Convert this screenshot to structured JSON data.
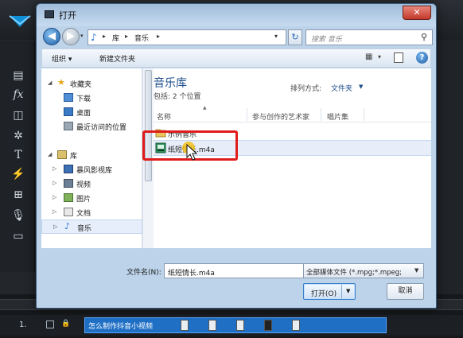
{
  "dialog": {
    "title": "打开",
    "close_glyph": "✕"
  },
  "address": {
    "crumbs": [
      "库",
      "音乐"
    ],
    "separator": "▸",
    "dropdown_glyph": "▾",
    "search_placeholder": "搜索 音乐",
    "refresh_glyph": "↻",
    "search_glyph": "⚲"
  },
  "toolbar": {
    "organize": "组织 ▾",
    "new_folder": "新建文件夹",
    "view_glyph": "▦",
    "dropdown_glyph": "▾",
    "help_glyph": "?"
  },
  "nav": {
    "items": [
      {
        "label": "收藏夹"
      },
      {
        "label": "下载"
      },
      {
        "label": "桌面"
      },
      {
        "label": "最近访问的位置"
      },
      {
        "label": "库"
      },
      {
        "label": "暴风影视库"
      },
      {
        "label": "视频"
      },
      {
        "label": "图片"
      },
      {
        "label": "文档"
      },
      {
        "label": "音乐"
      }
    ]
  },
  "content": {
    "library_title": "音乐库",
    "includes": "包括: 2 个位置",
    "arrange_label": "排列方式:",
    "arrange_value": "文件夹",
    "columns": [
      "名称",
      "参与创作的艺术家",
      "唱片集"
    ],
    "rows": [
      {
        "name": "示例音乐"
      },
      {
        "name": "纸短情长.m4a"
      }
    ]
  },
  "footer": {
    "filename_label": "文件名(N):",
    "filename_value": "纸短情长.m4a",
    "filetype_value": "全部媒体文件 (*.mpg;*.mpeg;",
    "open_label": "打开(O)",
    "cancel_label": "取消"
  },
  "background": {
    "track_label": "1.",
    "clip_title": "怎么制作抖音小视频"
  },
  "colors": {
    "highlight": "#e01b1b",
    "accent": "#1e4e8c",
    "clip": "#1f6fc5"
  }
}
